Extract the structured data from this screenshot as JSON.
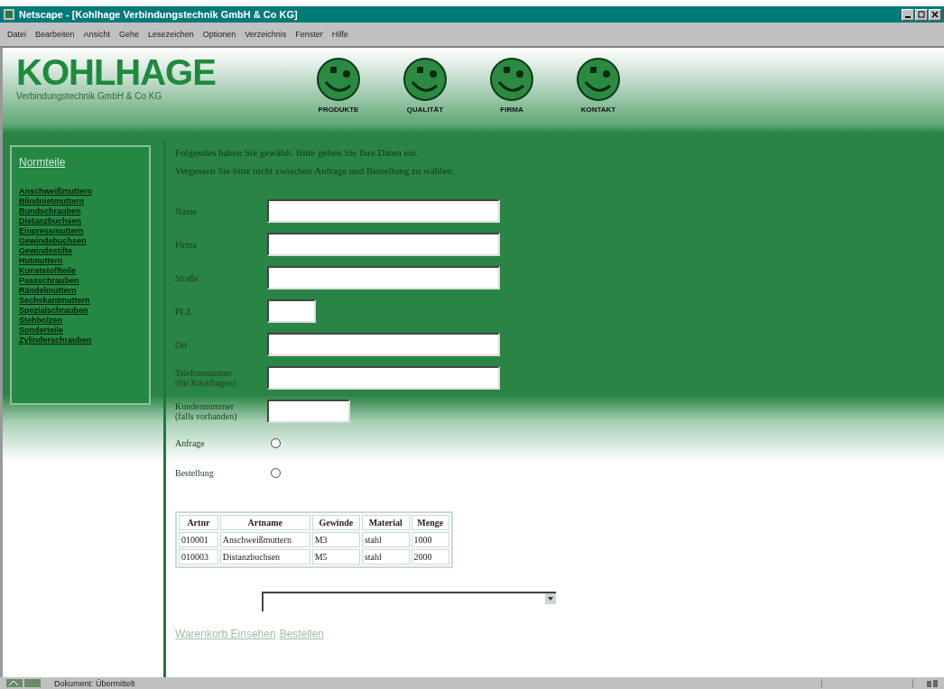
{
  "window": {
    "title": "Netscape - [Kohlhage Verbindungstechnik GmbH & Co KG]"
  },
  "menu": [
    "Datei",
    "Bearbeiten",
    "Ansicht",
    "Gehe",
    "Lesezeichen",
    "Optionen",
    "Verzeichnis",
    "Fenster",
    "Hilfe"
  ],
  "header": {
    "logo": "KOHLHAGE",
    "subtitle": "Verbindungstechnik GmbH & Co KG",
    "nav": [
      {
        "label": "PRODUKTE"
      },
      {
        "label": "QUALITÄT"
      },
      {
        "label": "FIRMA"
      },
      {
        "label": "KONTAKT"
      }
    ]
  },
  "sidebar": {
    "title": "Normteile",
    "items": [
      "Anschweißmuttern",
      "Blindnietmuttern",
      "Bundschrauben",
      "Distanzbuchsen",
      "Einpressmuttern",
      "Gewindebuchsen",
      "Gewindestifte",
      "Hutmuttern",
      "Kunststoffteile",
      "Passschrauben",
      "Rändelmuttern",
      "Sechskantmuttern",
      "Spezialschrauben",
      "Stehbolzen",
      "Sonderteile",
      "Zylinderschrauben"
    ]
  },
  "intro": [
    "Folgendes haben Sie gewählt. Bitte geben Sie Ihre Daten ein.",
    "Vergessen Sie bitte nicht zwischen Anfrage und Bestellung zu wählen."
  ],
  "fields": [
    {
      "label": "Name"
    },
    {
      "label": "Firma"
    },
    {
      "label": "Straße"
    },
    {
      "label": "PLZ"
    },
    {
      "label": "Ort"
    },
    {
      "label": "Telefonnummer (für Rückfragen)"
    },
    {
      "label": "Kundennummer (falls vorhanden)"
    }
  ],
  "options": [
    {
      "label": "Anfrage",
      "selected": false
    },
    {
      "label": "Bestellung",
      "selected": false
    }
  ],
  "table": {
    "columns": [
      "Artnr",
      "Artname",
      "Gewinde",
      "Material",
      "Menge"
    ],
    "rows": [
      [
        "010001",
        "Anschweißmuttern",
        "M3",
        "stahl",
        "1000"
      ],
      [
        "010003",
        "Distanzbuchsen",
        "M5",
        "stahl",
        "2000"
      ]
    ]
  },
  "links": [
    "Warenkorb Einsehen",
    "Bestellen"
  ],
  "status_bar": {
    "text": "Dokument: Übermittelt"
  }
}
